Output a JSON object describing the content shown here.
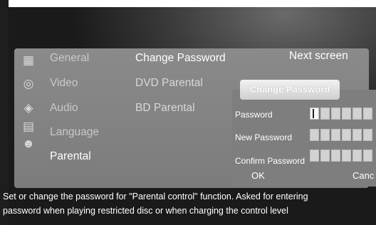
{
  "menu": {
    "items": [
      {
        "label": "General",
        "icon": "gear-box-icon"
      },
      {
        "label": "Video",
        "icon": "film-reel-icon"
      },
      {
        "label": "Audio",
        "icon": "speaker-icon"
      },
      {
        "label": "Language",
        "icon": "language-icon"
      },
      {
        "label": "Parental",
        "icon": "parental-icon"
      }
    ],
    "active": "Parental"
  },
  "submenu": {
    "items": [
      "Change Password",
      "DVD Parental",
      "BD Parental"
    ],
    "active": "Change Password"
  },
  "next_screen_label": "Next screen",
  "dialog": {
    "title": "Change Password",
    "fields": [
      {
        "label": "Password",
        "boxes": 6
      },
      {
        "label": "New Password",
        "boxes": 6
      },
      {
        "label": "Confirm Password",
        "boxes": 6
      }
    ],
    "ok_label": "OK",
    "cancel_label": "Canc"
  },
  "help": {
    "line1": "Set or change the password for \"Parental control\" function. Asked for entering",
    "line2": "password when playing restricted disc or when charging the control level"
  }
}
